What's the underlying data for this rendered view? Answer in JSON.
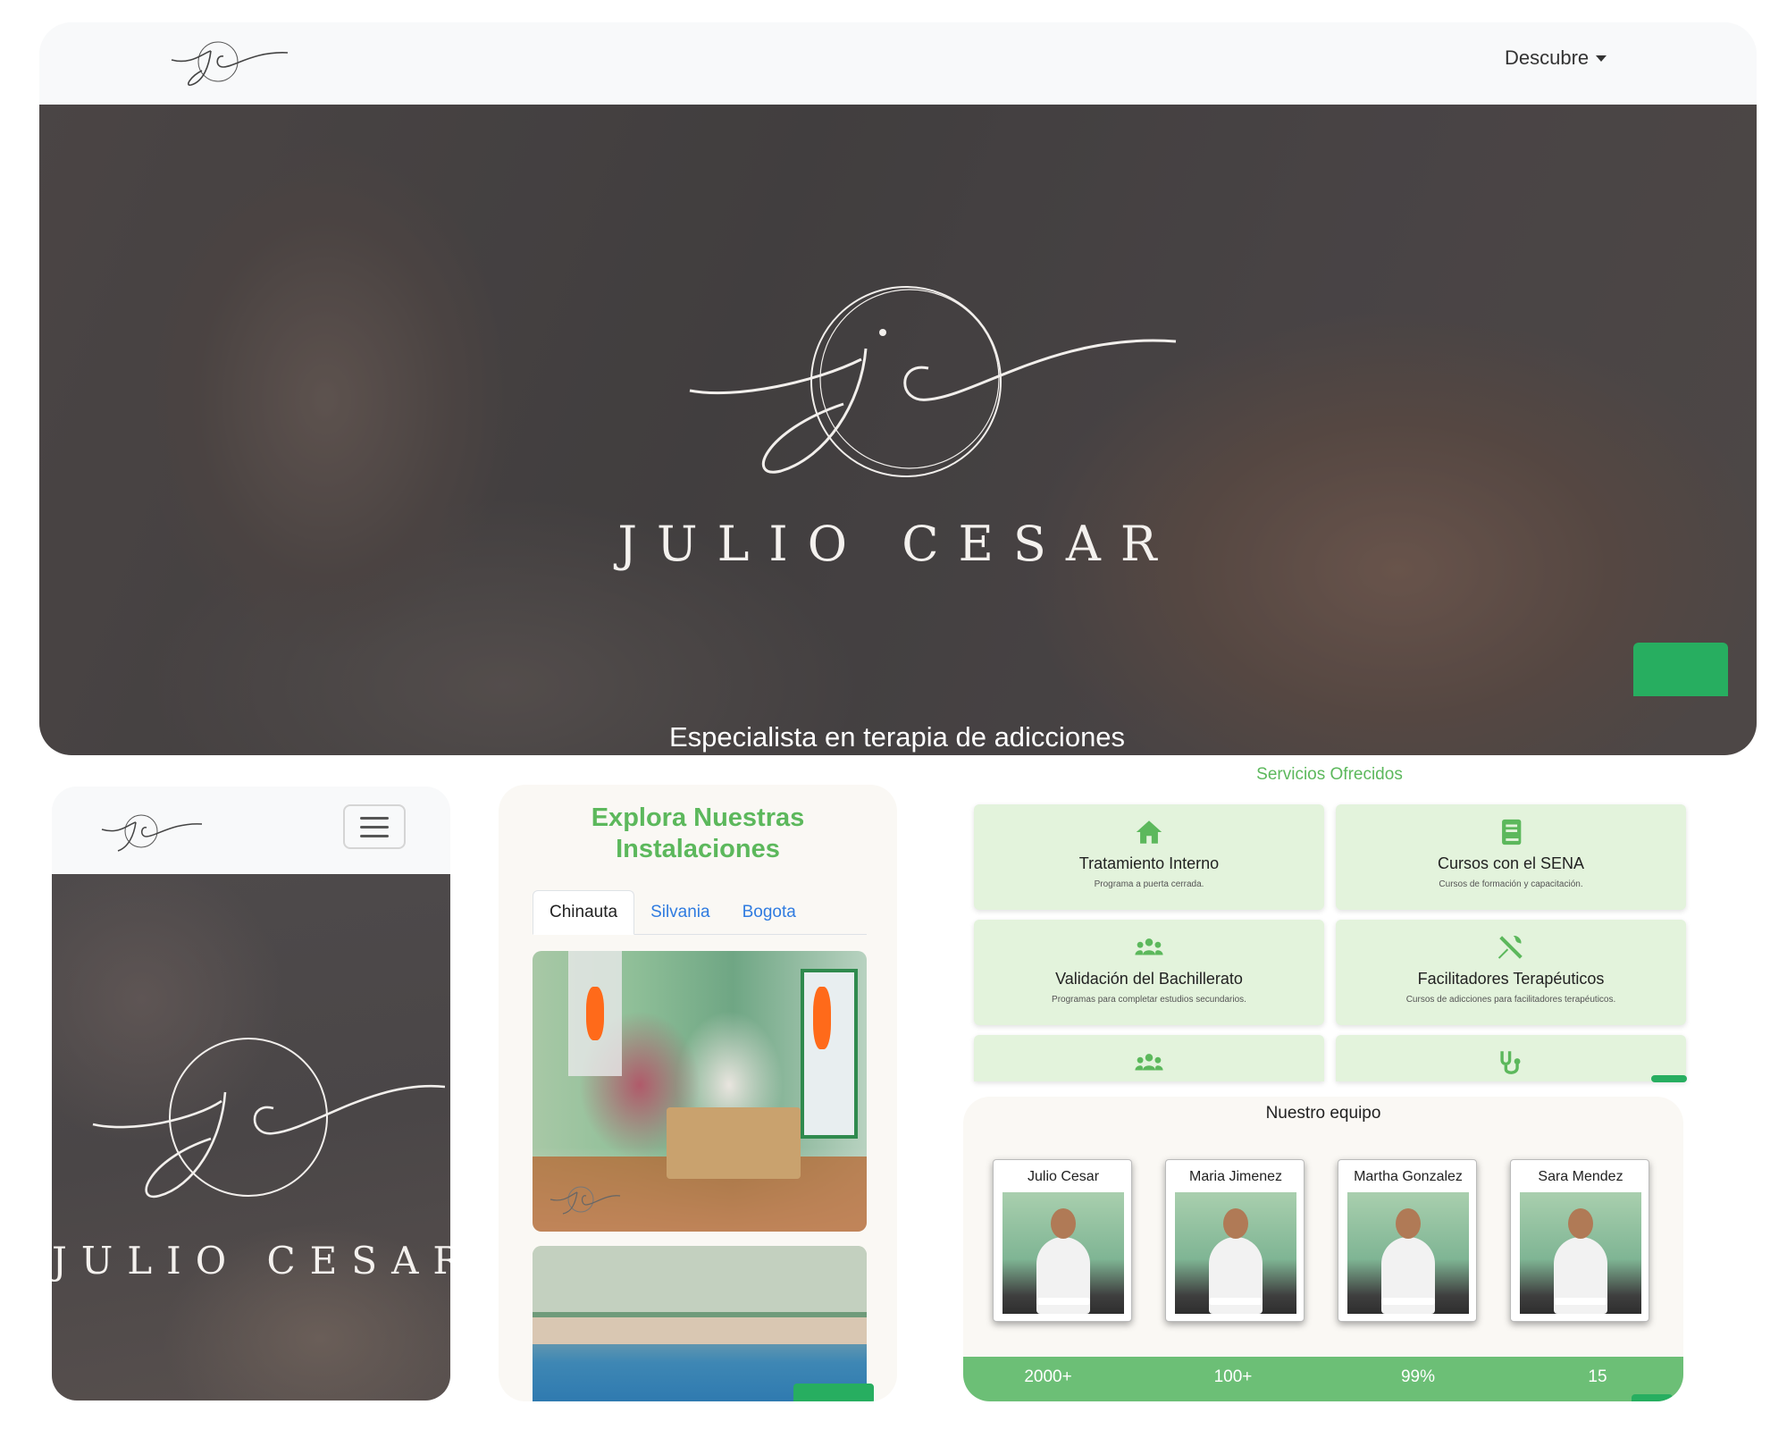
{
  "brand": {
    "name": "JULIO CESAR",
    "tagline": "Especialista en terapia de adicciones"
  },
  "navbar": {
    "dropdown_label": "Descubre"
  },
  "facilities": {
    "title_line1": "Explora Nuestras",
    "title_line2": "Instalaciones",
    "tabs": [
      {
        "label": "Chinauta",
        "active": true
      },
      {
        "label": "Silvania",
        "active": false
      },
      {
        "label": "Bogota",
        "active": false
      }
    ]
  },
  "services": {
    "title": "Servicios Ofrecidos",
    "items": [
      {
        "icon": "home-icon",
        "title": "Tratamiento Interno",
        "desc": "Programa a puerta cerrada."
      },
      {
        "icon": "book-icon",
        "title": "Cursos con el SENA",
        "desc": "Cursos de formación y capacitación."
      },
      {
        "icon": "users-icon",
        "title": "Validación del Bachillerato",
        "desc": "Programas para completar estudios secundarios."
      },
      {
        "icon": "tools-icon",
        "title": "Facilitadores Terapéuticos",
        "desc": "Cursos de adicciones para facilitadores terapéuticos."
      },
      {
        "icon": "users-icon",
        "title": "",
        "desc": ""
      },
      {
        "icon": "stethoscope-icon",
        "title": "",
        "desc": ""
      }
    ]
  },
  "team": {
    "title": "Nuestro equipo",
    "members": [
      {
        "name": "Julio Cesar"
      },
      {
        "name": "Maria Jimenez"
      },
      {
        "name": "Martha Gonzalez"
      },
      {
        "name": "Sara Mendez"
      }
    ]
  },
  "stats": [
    {
      "value": "2000+"
    },
    {
      "value": "100+"
    },
    {
      "value": "99%"
    },
    {
      "value": "15"
    }
  ],
  "colors": {
    "accent_green": "#5cb85c",
    "card_green": "#e3f3dc",
    "stats_bar": "#6cbf76",
    "whatsapp": "#27ae60",
    "link_blue": "#2f7be0"
  }
}
